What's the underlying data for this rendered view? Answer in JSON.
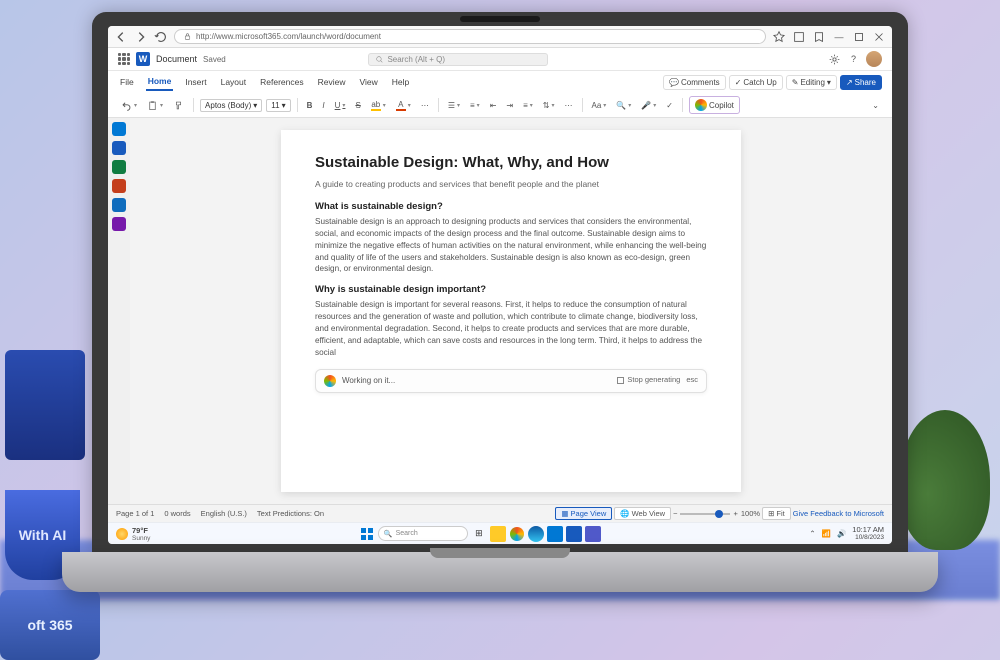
{
  "browser": {
    "url": "http://www.microsoft365.com/launch/word/document"
  },
  "app": {
    "doc_name": "Document",
    "save_state": "Saved",
    "search_placeholder": "Search (Alt + Q)"
  },
  "tabs": {
    "file": "File",
    "home": "Home",
    "insert": "Insert",
    "layout": "Layout",
    "references": "References",
    "review": "Review",
    "view": "View",
    "help": "Help"
  },
  "ribbon_right": {
    "comments": "Comments",
    "catchup": "Catch Up",
    "editing": "Editing",
    "share": "Share"
  },
  "toolbar": {
    "font": "Aptos (Body)",
    "size": "11",
    "copilot": "Copilot"
  },
  "document": {
    "title": "Sustainable Design: What, Why, and How",
    "subtitle": "A guide to creating products and services that benefit people and the planet",
    "h_what": "What is sustainable design?",
    "p_what": "Sustainable design is an approach to designing products and services that considers the environmental, social, and economic impacts of the design process and the final outcome. Sustainable design aims to minimize the negative effects of human activities on the natural environment, while enhancing the well-being and quality of life of the users and stakeholders. Sustainable design is also known as eco-design, green design, or environmental design.",
    "h_why": "Why is sustainable design important?",
    "p_why": "Sustainable design is important for several reasons. First, it helps to reduce the consumption of natural resources and the generation of waste and pollution, which contribute to climate change, biodiversity loss, and environmental degradation. Second, it helps to create products and services that are more durable, efficient, and adaptable, which can save costs and resources in the long term. Third, it helps to address the social"
  },
  "copilot": {
    "status": "Working on it...",
    "stop": "Stop generating",
    "esc": "esc"
  },
  "status": {
    "page": "Page 1 of 1",
    "words": "0 words",
    "lang": "English (U.S.)",
    "predict": "Text Predictions: On",
    "page_view": "Page View",
    "web_view": "Web View",
    "zoom": "100%",
    "fit": "Fit",
    "feedback": "Give Feedback to Microsoft"
  },
  "taskbar": {
    "temp": "79°F",
    "weather": "Sunny",
    "search": "Search",
    "time": "10:17 AM",
    "date": "10/8/2023"
  },
  "decor": {
    "mug1": "With AI",
    "box": "oft 365"
  }
}
